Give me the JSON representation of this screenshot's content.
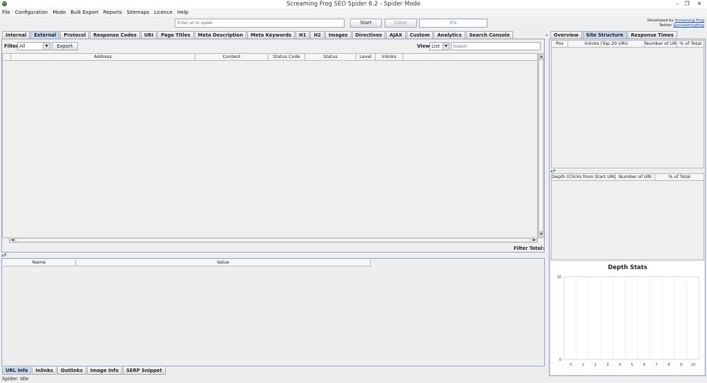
{
  "window": {
    "title": "Screaming Frog SEO Spider 6.2 - Spider Mode"
  },
  "menu": [
    "File",
    "Configuration",
    "Mode",
    "Bulk Export",
    "Reports",
    "Sitemaps",
    "Licence",
    "Help"
  ],
  "toolbar": {
    "url_placeholder": "Enter url to spider",
    "start_label": "Start",
    "clear_label": "Clear",
    "progress": "0%",
    "progress_value": 0
  },
  "developer": {
    "line1_prefix": "Developed by",
    "line1_link": "Screaming Frog",
    "line2_prefix": "Twitter",
    "line2_link": "@screamingfrog"
  },
  "main_tabs": [
    "Internal",
    "External",
    "Protocol",
    "Response Codes",
    "URI",
    "Page Titles",
    "Meta Description",
    "Meta Keywords",
    "H1",
    "H2",
    "Images",
    "Directives",
    "AJAX",
    "Custom",
    "Analytics",
    "Search Console"
  ],
  "active_main_tab": "External",
  "filter": {
    "label": "Filter:",
    "value": "All",
    "export_label": "Export"
  },
  "view": {
    "label": "View:",
    "value": "List",
    "search_placeholder": "Search"
  },
  "main_table": {
    "columns": [
      "Address",
      "Content",
      "Status Code",
      "Status",
      "Level",
      "Inlinks"
    ]
  },
  "filter_total": "Filter Total:",
  "detail_table": {
    "columns": [
      "Name",
      "Value"
    ]
  },
  "bottom_tabs": [
    "URL Info",
    "Inlinks",
    "Outlinks",
    "Image Info",
    "SERP Snippet"
  ],
  "active_bottom_tab": "URL Info",
  "status": "Spider: Idle",
  "right_tabs": [
    "Overview",
    "Site Structure",
    "Response Times"
  ],
  "active_right_tab": "Site Structure",
  "inlinks_table": {
    "columns": [
      "Pos",
      "Inlinks (Top 20 URI)",
      "Number of URI",
      "% of Total"
    ]
  },
  "depth_table": {
    "columns": [
      "Depth (Clicks from Start URL)",
      "Number of URI",
      "% of Total"
    ]
  },
  "chart_data": {
    "type": "bar",
    "title": "Depth Stats",
    "categories": [
      "0",
      "1",
      "2",
      "3",
      "4",
      "5",
      "6",
      "7",
      "8",
      "9",
      "10"
    ],
    "values": [
      0,
      0,
      0,
      0,
      0,
      0,
      0,
      0,
      0,
      0,
      0
    ],
    "ylim": [
      0,
      10
    ],
    "yticks": [
      "0",
      "10"
    ],
    "grid": true,
    "bar_color": "#6f8fbf"
  }
}
